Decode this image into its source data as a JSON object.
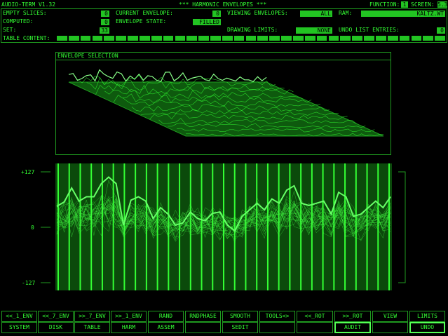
{
  "header": {
    "app_title": "AUDIO-TERM V1.32",
    "screen_title": "*** HARMONIC ENVELOPES ***",
    "function_label": "FUNCTION:",
    "function_value": "1",
    "screen_label": "SCREEN:",
    "screen_value": "5.3"
  },
  "status": {
    "empty_slices_label": "EMPTY SLICES:",
    "empty_slices_value": "0",
    "computed_label": "COMPUTED:",
    "computed_value": "0",
    "set_label": "SET:",
    "set_value": "33",
    "current_envelope_label": "CURRENT ENVELOPE:",
    "current_envelope_value": "0",
    "envelope_state_label": "ENVELOPE STATE:",
    "envelope_state_value": "FILLED",
    "viewing_envelopes_label": "VIEWING ENVELOPES:",
    "viewing_envelopes_value": "ALL",
    "drawing_limits_label": "DRAWING LIMITS:",
    "drawing_limits_value": "NONE",
    "ram_label": "RAM:",
    "ram_value": "KALTZ.WT",
    "undo_entries_label": "UNDO LIST ENTRIES:",
    "undo_entries_value": "0",
    "table_content_label": "TABLE CONTENT:"
  },
  "envelope_panel": {
    "title": "ENVELOPE SELECTION"
  },
  "editor": {
    "y_top": "+127",
    "y_mid": "0",
    "y_bottom": "-127",
    "columns": 31,
    "current_envelope": [
      48,
      58,
      90,
      60,
      70,
      70,
      100,
      115,
      100,
      5,
      62,
      70,
      60,
      20,
      45,
      30,
      5,
      10,
      35,
      20,
      15,
      32,
      35,
      5,
      -8,
      25,
      40,
      55,
      40,
      65,
      55,
      85,
      95,
      55,
      50,
      55,
      60,
      30,
      80,
      70,
      25,
      30,
      45,
      60,
      45,
      70
    ]
  },
  "buttons": {
    "row1": [
      "<<_1_ENV",
      "<<_7_ENV",
      ">>_7_ENV",
      ">>_1_ENV",
      "RAND",
      "RNDPHASE",
      "SMOOTH",
      "TOOLS<>",
      "<<_ROT",
      ">>_ROT",
      "VIEW",
      "LIMITS"
    ],
    "row2": [
      "SYSTEM",
      "DISK",
      "TABLE",
      "HARM",
      "ASSEM",
      "",
      "SEDIT",
      "",
      "",
      "AUDIT",
      "",
      "UNDO"
    ]
  }
}
